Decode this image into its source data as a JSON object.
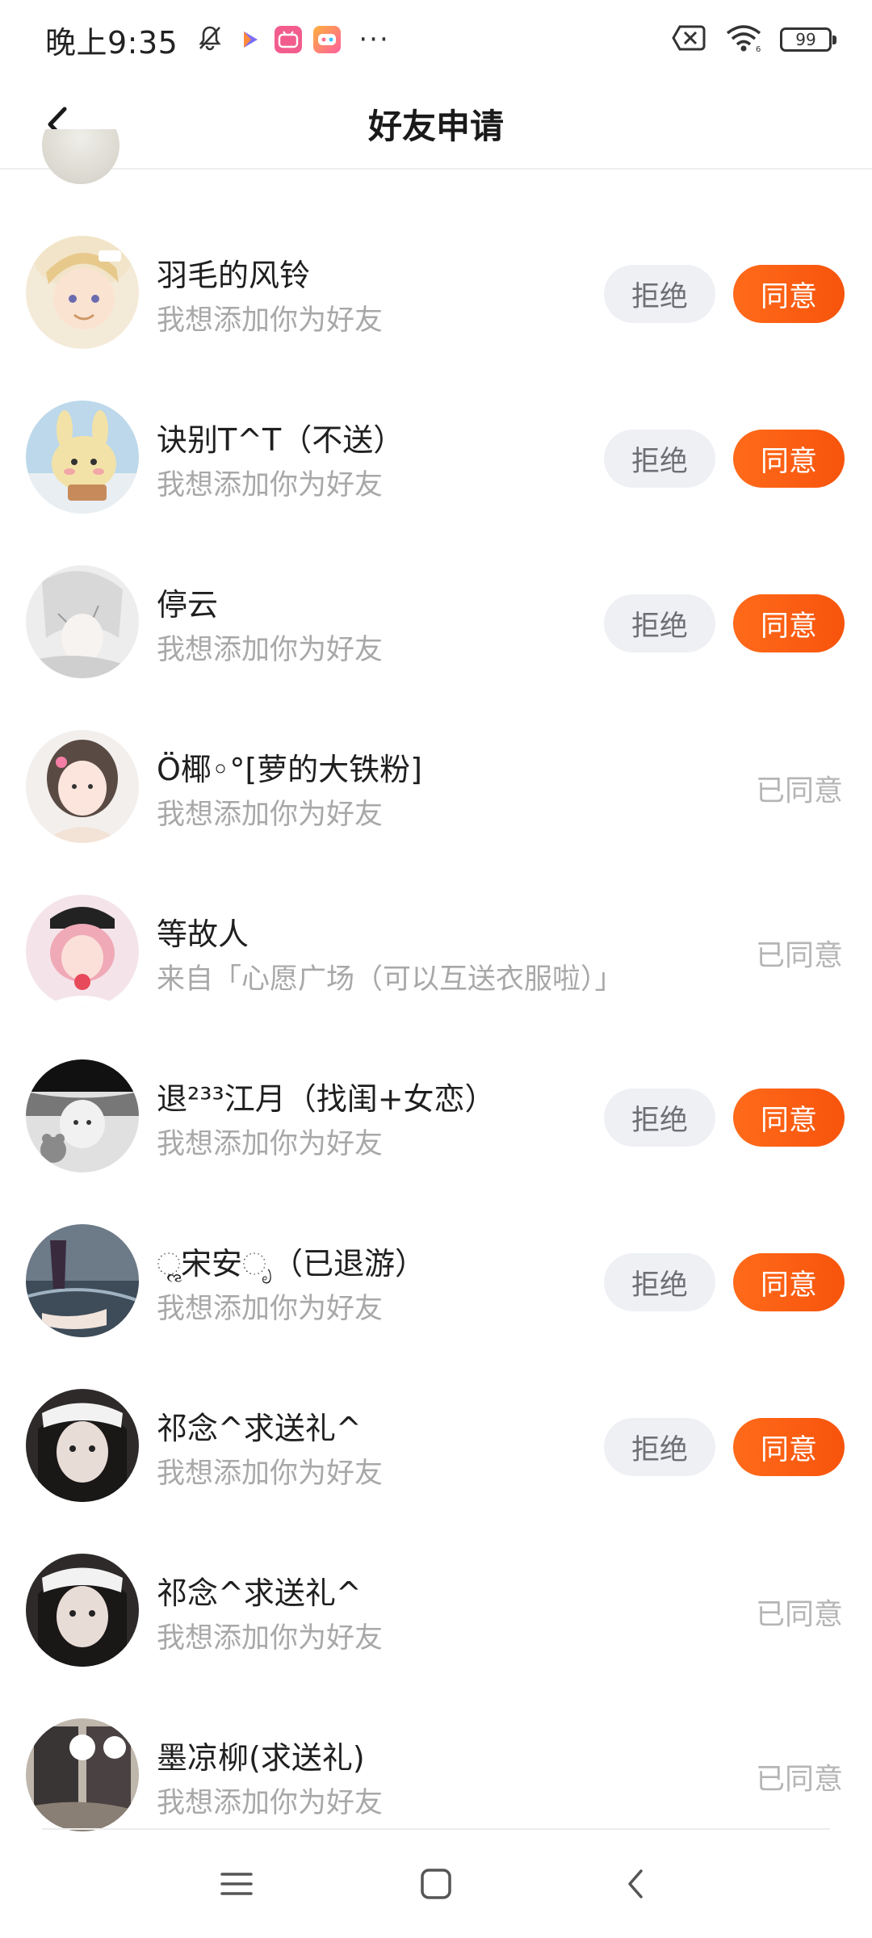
{
  "status_bar": {
    "time": "晚上9:35",
    "battery": "99",
    "app_icons": [
      "mute-bell-icon",
      "video-app-icon",
      "bilibili-icon",
      "game-app-icon"
    ]
  },
  "header": {
    "title": "好友申请",
    "back_icon": "chevron-left-icon"
  },
  "labels": {
    "reject": "拒绝",
    "accept": "同意",
    "accepted": "已同意"
  },
  "requests": [
    {
      "name": "羽毛的风铃",
      "message": "我想添加你为好友",
      "state": "pending"
    },
    {
      "name": "诀别T^T（不送）",
      "message": "我想添加你为好友",
      "state": "pending"
    },
    {
      "name": "停云",
      "message": "我想添加你为好友",
      "state": "pending"
    },
    {
      "name": "Ö椰◦°[萝的大铁粉]",
      "message": "我想添加你为好友",
      "state": "accepted"
    },
    {
      "name": "等故人",
      "message": "来自「心愿广场（可以互送衣服啦）」",
      "state": "accepted"
    },
    {
      "name": "退²³³江月（找闺+女恋）",
      "message": "我想添加你为好友",
      "state": "pending"
    },
    {
      "name": "ૢ宋安ೃ（已退游）",
      "message": "我想添加你为好友",
      "state": "pending"
    },
    {
      "name": "祁念^求送礼^",
      "message": "我想添加你为好友",
      "state": "pending"
    },
    {
      "name": "祁念^求送礼^",
      "message": "我想添加你为好友",
      "state": "accepted"
    },
    {
      "name": "墨凉柳(求送礼)",
      "message": "我想添加你为好友",
      "state": "accepted"
    }
  ],
  "colors": {
    "accent": "#f75a10",
    "reject_bg": "#eef0f4",
    "subtext": "#a8a8a8"
  },
  "nav": [
    "menu-icon",
    "home-icon",
    "back-icon"
  ]
}
